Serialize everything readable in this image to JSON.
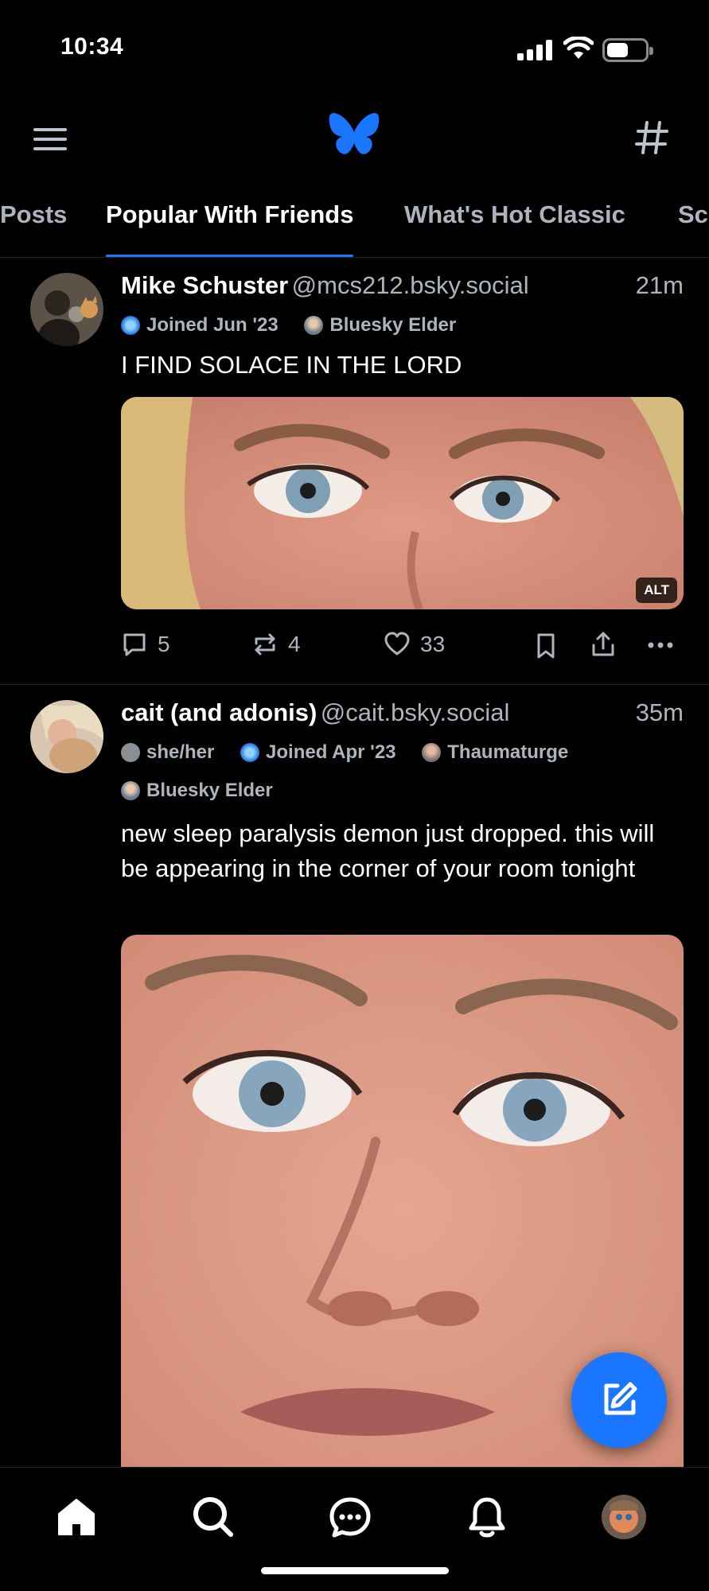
{
  "status_bar": {
    "time": "10:34"
  },
  "feed_tabs": [
    {
      "label": "Posts",
      "active": false
    },
    {
      "label": "Popular With Friends",
      "active": true
    },
    {
      "label": "What's Hot Classic",
      "active": false
    },
    {
      "label": "Sc",
      "active": false
    }
  ],
  "posts": [
    {
      "display_name": "Mike Schuster",
      "handle": "@mcs212.bsky.social",
      "time": "21m",
      "badges": [
        "Joined Jun '23",
        "Bluesky Elder"
      ],
      "text": "I FIND SOLACE IN THE LORD",
      "media_alt_badge": "ALT",
      "replies": "5",
      "reposts": "4",
      "likes": "33"
    },
    {
      "display_name": "cait (and adonis)",
      "handle": "@cait.bsky.social",
      "time": "35m",
      "badges": [
        "she/her",
        "Joined Apr '23",
        "Thaumaturge",
        "Bluesky Elder"
      ],
      "text": "new sleep paralysis demon just dropped. this will be appearing in the corner of your room tonight"
    }
  ],
  "colors": {
    "accent": "#1a75ff",
    "muted": "#aeb4bd",
    "background": "#000000"
  }
}
